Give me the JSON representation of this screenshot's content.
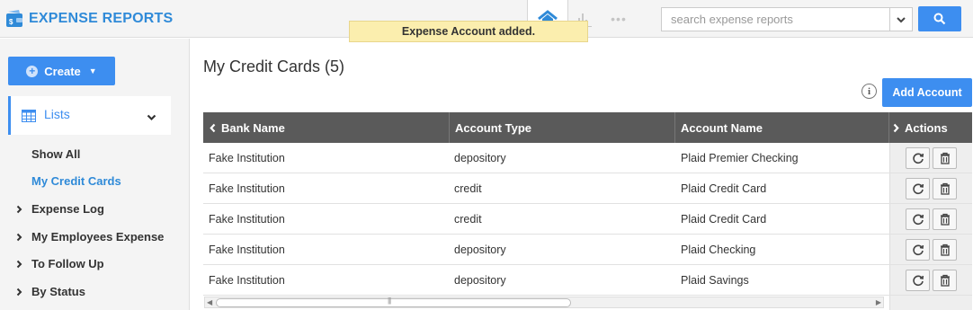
{
  "header": {
    "app_title": "EXPENSE REPORTS",
    "nav": {
      "more_label": "•••"
    },
    "search": {
      "placeholder": "search expense reports"
    }
  },
  "toast": {
    "message": "Expense Account added."
  },
  "sidebar": {
    "create_label": "Create",
    "lists_label": "Lists",
    "items": [
      {
        "label": "Show All",
        "active": false
      },
      {
        "label": "My Credit Cards",
        "active": true
      },
      {
        "label": "Expense Log"
      },
      {
        "label": "My Employees Expense"
      },
      {
        "label": "To Follow Up"
      },
      {
        "label": "By Status"
      }
    ]
  },
  "main": {
    "page_title": "My Credit Cards (5)",
    "info_label": "i",
    "add_button_label": "Add Account"
  },
  "table": {
    "columns": [
      "Bank Name",
      "Account Type",
      "Account Name",
      "Actions"
    ],
    "rows": [
      {
        "bank": "Fake Institution",
        "type": "depository",
        "name": "Plaid Premier Checking"
      },
      {
        "bank": "Fake Institution",
        "type": "credit",
        "name": "Plaid Credit Card"
      },
      {
        "bank": "Fake Institution",
        "type": "credit",
        "name": "Plaid Credit Card"
      },
      {
        "bank": "Fake Institution",
        "type": "depository",
        "name": "Plaid Checking"
      },
      {
        "bank": "Fake Institution",
        "type": "depository",
        "name": "Plaid Savings"
      }
    ]
  },
  "colors": {
    "accent": "#3d8ef0",
    "header_bg": "#5a5a5a",
    "toast_bg": "#fbeeae"
  }
}
